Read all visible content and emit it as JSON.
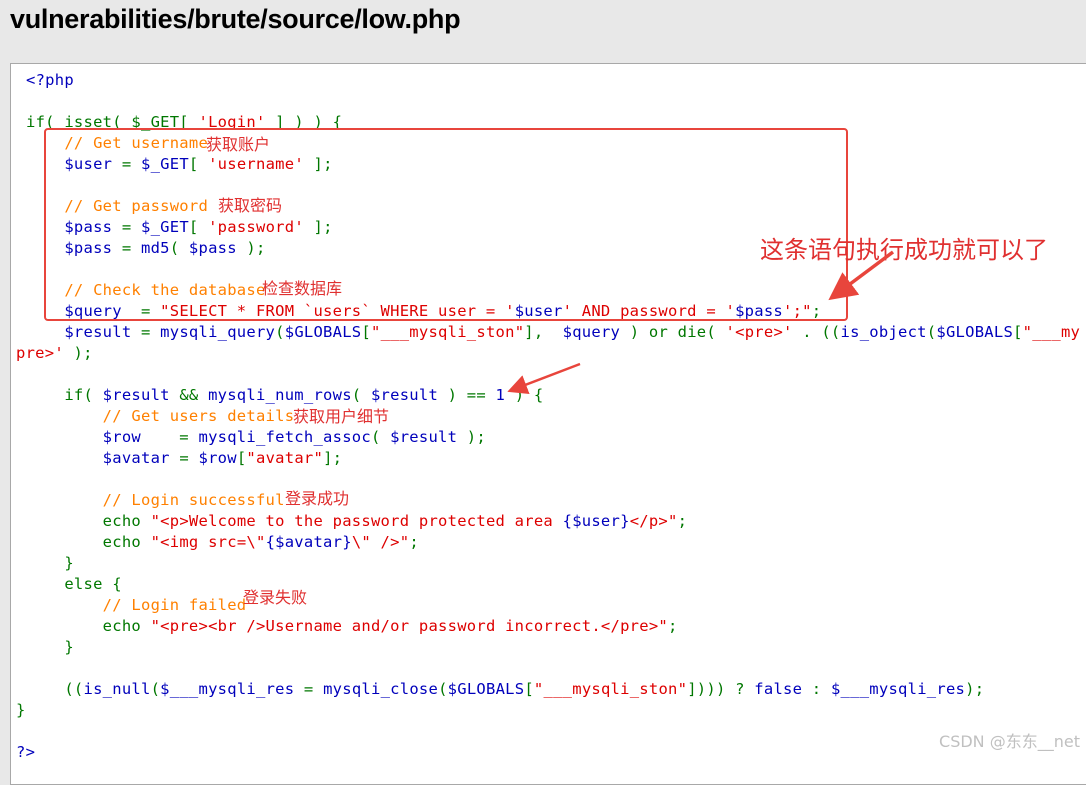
{
  "header": {
    "title": "vulnerabilities/brute/source/low.php"
  },
  "code": {
    "l01": "<?php",
    "l03_a": "if( isset( $_GET[ ",
    "l03_b": "'Login'",
    "l03_c": " ] ) ) {",
    "l04": "// Get username",
    "l05_a": "$user",
    "l05_b": " = ",
    "l05_c": "$_GET",
    "l05_d": "[ ",
    "l05_e": "'username'",
    "l05_f": " ];",
    "l07": "// Get password",
    "l08_a": "$pass",
    "l08_b": " = ",
    "l08_c": "$_GET",
    "l08_d": "[ ",
    "l08_e": "'password'",
    "l08_f": " ];",
    "l09_a": "$pass",
    "l09_b": " = ",
    "l09_c": "md5",
    "l09_d": "( ",
    "l09_e": "$pass",
    "l09_f": " );",
    "l11": "// Check the database",
    "l12_a": "$query",
    "l12_b": "  = ",
    "l12_c": "\"SELECT * FROM `users` WHERE user = '",
    "l12_d": "$user",
    "l12_e": "' AND password = '",
    "l12_f": "$pass",
    "l12_g": "';\"",
    "l12_h": ";",
    "l13_a": "$result",
    "l13_b": " = ",
    "l13_c": "mysqli_query",
    "l13_d": "(",
    "l13_e": "$GLOBALS",
    "l13_f": "[",
    "l13_g": "\"___mysqli_ston\"",
    "l13_h": "],  ",
    "l13_i": "$query",
    "l13_j": " ) or die( ",
    "l13_k": "'<pre>'",
    "l13_l": " . ((",
    "l13_m": "is_object",
    "l13_n": "(",
    "l13_o": "$GLOBALS",
    "l13_p": "[",
    "l13_q": "\"___my",
    "l14_a": "pre>'",
    "l14_b": " );",
    "l16_a": "if( ",
    "l16_b": "$result",
    "l16_c": " && ",
    "l16_d": "mysqli_num_rows",
    "l16_e": "( ",
    "l16_f": "$result",
    "l16_g": " ) == ",
    "l16_h": "1",
    "l16_i": " ) {",
    "l17": "// Get users details",
    "l18_a": "$row",
    "l18_b": "    = ",
    "l18_c": "mysqli_fetch_assoc",
    "l18_d": "( ",
    "l18_e": "$result",
    "l18_f": " );",
    "l19_a": "$avatar",
    "l19_b": " = ",
    "l19_c": "$row",
    "l19_d": "[",
    "l19_e": "\"avatar\"",
    "l19_f": "];",
    "l21": "// Login successful",
    "l22_a": "echo ",
    "l22_b": "\"<p>Welcome to the password protected area ",
    "l22_c": "{$user}",
    "l22_d": "</p>\"",
    "l22_e": ";",
    "l23_a": "echo ",
    "l23_b": "\"<img src=\\\"",
    "l23_c": "{$avatar}",
    "l23_d": "\\\" />\"",
    "l23_e": ";",
    "l24": "}",
    "l25": "else {",
    "l26": "// Login failed",
    "l27_a": "echo ",
    "l27_b": "\"<pre><br />Username and/or password incorrect.</pre>\"",
    "l27_c": ";",
    "l28": "}",
    "l30_a": "((",
    "l30_b": "is_null",
    "l30_c": "(",
    "l30_d": "$___mysqli_res",
    "l30_e": " = ",
    "l30_f": "mysqli_close",
    "l30_g": "(",
    "l30_h": "$GLOBALS",
    "l30_i": "[",
    "l30_j": "\"___mysqli_ston\"",
    "l30_k": "]))) ? ",
    "l30_l": "false",
    "l30_m": " : ",
    "l30_n": "$___mysqli_res",
    "l30_o": ");",
    "l31": "}",
    "l33": "?>"
  },
  "annotations": {
    "get_account": "获取账户",
    "get_password": "获取密码",
    "check_database": "检查数据库",
    "statement_success": "这条语句执行成功就可以了",
    "get_user_details": "获取用户细节",
    "login_success": "登录成功",
    "login_failed": "登录失败"
  },
  "colors": {
    "keyword": "#007700",
    "string": "#dd0000",
    "variable": "#0000bb",
    "comment": "#ff8000",
    "annotation": "#e03030"
  },
  "watermark": "CSDN @东东__net"
}
